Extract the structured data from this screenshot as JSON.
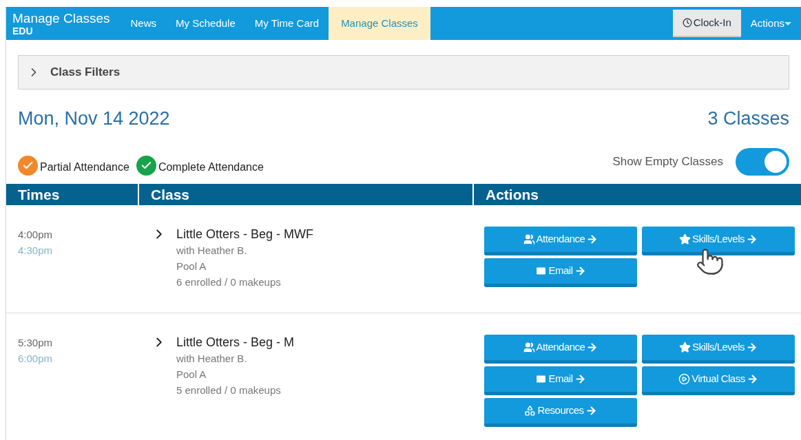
{
  "header": {
    "title": "Manage Classes",
    "subtitle": "EDU",
    "nav": [
      {
        "label": "News",
        "selected": false
      },
      {
        "label": "My Schedule",
        "selected": false
      },
      {
        "label": "My Time Card",
        "selected": false
      },
      {
        "label": "Manage Classes",
        "selected": true
      }
    ],
    "clock_in": "Clock-In",
    "actions": "Actions"
  },
  "filters": {
    "label": "Class Filters",
    "expanded": false
  },
  "date": "Mon, Nov 14 2022",
  "count": "3 Classes",
  "legend": [
    {
      "label": "Partial Attendance",
      "color": "#f0892a"
    },
    {
      "label": "Complete Attendance",
      "color": "#17a34a"
    }
  ],
  "show_empty": {
    "label": "Show Empty Classes",
    "on": true
  },
  "table": {
    "columns": [
      "Times",
      "Class",
      "Actions"
    ],
    "rows": [
      {
        "start": "4:00pm",
        "end": "4:30pm",
        "name": "Little Otters - Beg - MWF",
        "instructor": "with Heather B.",
        "location": "Pool A",
        "enrollment": "6 enrolled / 0 makeups",
        "cursor": true,
        "buttons": [
          {
            "kind": "attendance",
            "label": "Attendance"
          },
          {
            "kind": "skills",
            "label": "Skills/Levels"
          },
          {
            "kind": "email",
            "label": "Email"
          }
        ]
      },
      {
        "start": "5:30pm",
        "end": "6:00pm",
        "name": "Little Otters - Beg - M",
        "instructor": "with Heather B.",
        "location": "Pool A",
        "enrollment": "5 enrolled / 0 makeups",
        "cursor": false,
        "buttons": [
          {
            "kind": "attendance",
            "label": "Attendance"
          },
          {
            "kind": "skills",
            "label": "Skills/Levels"
          },
          {
            "kind": "email",
            "label": "Email"
          },
          {
            "kind": "virtual",
            "label": "Virtual Class"
          },
          {
            "kind": "resources",
            "label": "Resources"
          }
        ]
      }
    ]
  }
}
